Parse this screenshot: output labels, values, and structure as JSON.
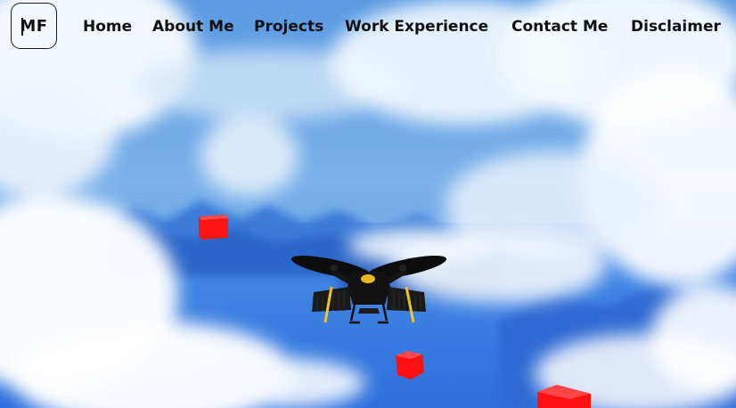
{
  "logo": {
    "text": "MF"
  },
  "nav": {
    "items": [
      {
        "label": "Home"
      },
      {
        "label": "About Me"
      },
      {
        "label": "Projects"
      },
      {
        "label": "Work Experience"
      },
      {
        "label": "Contact Me"
      },
      {
        "label": "Disclaimer"
      }
    ]
  },
  "colors": {
    "sky": "#6aa6e6",
    "cloud": "#ffffff",
    "mountain": "#2f6bd6",
    "cube": "#ff1a1a",
    "drone_body": "#111111",
    "drone_accent": "#f2c230"
  }
}
